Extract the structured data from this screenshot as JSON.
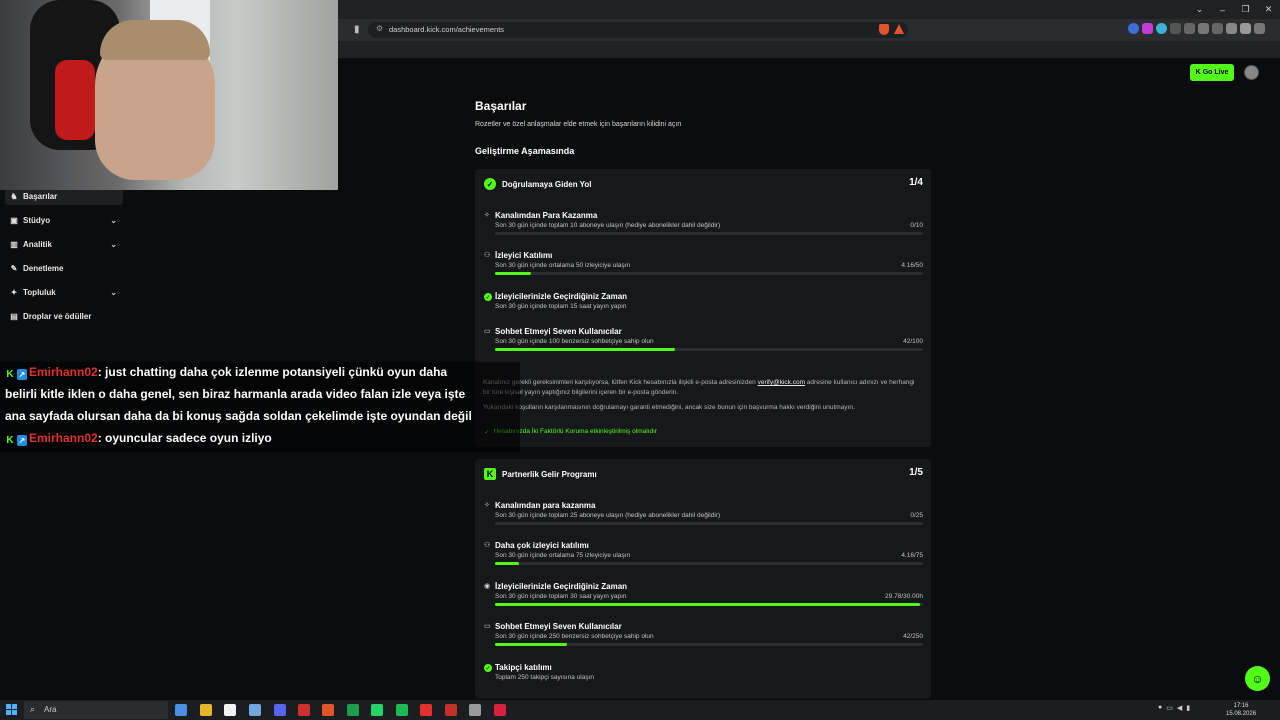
{
  "browser": {
    "url": "dashboard.kick.com/achievements",
    "window_controls": [
      "⌄",
      "–",
      "❐",
      "✕"
    ]
  },
  "header": {
    "go_live_label": "Go Live"
  },
  "sidebar": {
    "items": [
      {
        "label": "Başarılar",
        "icon": "trophy-icon",
        "glyph": "♞",
        "expand": false,
        "active": true
      },
      {
        "label": "Stüdyo",
        "icon": "studio-icon",
        "glyph": "▣",
        "expand": true,
        "active": false
      },
      {
        "label": "Analitik",
        "icon": "analytics-icon",
        "glyph": "▥",
        "expand": true,
        "active": false
      },
      {
        "label": "Denetleme",
        "icon": "moderation-icon",
        "glyph": "✎",
        "expand": false,
        "active": false
      },
      {
        "label": "Topluluk",
        "icon": "community-icon",
        "glyph": "✦",
        "expand": true,
        "active": false
      },
      {
        "label": "Droplar ve ödüller",
        "icon": "drops-icon",
        "glyph": "▤",
        "expand": false,
        "active": false
      }
    ]
  },
  "main": {
    "title": "Başarılar",
    "subtitle": "Rozetler ve özel anlaşmalar elde etmek için başarıların kilidini açın",
    "section_title": "Geliştirme Aşamasında",
    "verified_card": {
      "title": "Doğrulamaya Giden Yol",
      "count": "1/4",
      "tasks": [
        {
          "title": "Kanalımdan Para Kazanma",
          "desc": "Son 30 gün içinde toplam 10 aboneye ulaşın (hediye abonelikler dahil değildir)",
          "value": "0/10",
          "progress": 0.0,
          "icon": "money-icon",
          "glyph": "✧",
          "done": false
        },
        {
          "title": "İzleyici Katılımı",
          "desc": "Son 30 gün içinde ortalama 50 izleyiciye ulaşın",
          "value": "4.16/50",
          "progress": 0.083,
          "icon": "viewers-icon",
          "glyph": "⚇",
          "done": false
        },
        {
          "title": "İzleyicilerinizle Geçirdiğiniz Zaman",
          "desc": "Son 30 gün içinde toplam 15 saat yayın yapın",
          "value": "",
          "progress": null,
          "icon": "check-circle-icon",
          "glyph": "✓",
          "done": true
        },
        {
          "title": "Sohbet Etmeyi Seven Kullanıcılar",
          "desc": "Son 30 gün içinde 100 benzersiz sohbetçiye sahip olun",
          "value": "42/100",
          "progress": 0.42,
          "icon": "chat-icon",
          "glyph": "▭",
          "done": false
        }
      ],
      "info_text1_a": "Kanalınız gerekli gereksinimleri karşılıyorsa, lütfen Kick hesabınızla ilişkili e-posta adresinizden ",
      "info_link": "verify@kick.com",
      "info_text1_b": " adresine kullanıcı adınızı ve herhangi bir türe kişisel yayın yaptığınız bilgilerini içeren bir e-posta gönderin.",
      "info_text2": "Yukarıdaki koşulların karşılanmasının doğrulamayı garanti etmediğini, ancak size bunun için başvurma hakkı verdiğini unutmayın.",
      "requirement": "Hesabınızda İki Faktörlü Koruma etkinleştirilmiş olmalıdır"
    },
    "partner_card": {
      "title": "Partnerlik Gelir Programı",
      "count": "1/5",
      "tasks": [
        {
          "title": "Kanalımdan para kazanma",
          "desc": "Son 30 gün içinde toplam 25 aboneye ulaşın (hediye abonelikler dahil değildir)",
          "value": "0/25",
          "progress": 0.0,
          "icon": "money-icon",
          "glyph": "✧",
          "done": false
        },
        {
          "title": "Daha çok izleyici katılımı",
          "desc": "Son 30 gün içinde ortalama 75 izleyiciye ulaşın",
          "value": "4.16/75",
          "progress": 0.055,
          "icon": "viewers-icon",
          "glyph": "⚇",
          "done": false
        },
        {
          "title": "İzleyicilerinizle Geçirdiğiniz Zaman",
          "desc": "Son 30 gün içinde toplam 30 saat yayın yapın",
          "value": "29.78/30.00h",
          "progress": 0.993,
          "icon": "broadcast-icon",
          "glyph": "◉",
          "done": false
        },
        {
          "title": "Sohbet Etmeyi Seven Kullanıcılar",
          "desc": "Son 30 gün içinde 250 benzersiz sohbetçiye sahip olun",
          "value": "42/250",
          "progress": 0.168,
          "icon": "chat-icon",
          "glyph": "▭",
          "done": false
        },
        {
          "title": "Takipçi katılımı",
          "desc": "Toplam 250 takipçi sayısına ulaşın",
          "value": "",
          "progress": null,
          "icon": "check-circle-icon",
          "glyph": "✓",
          "done": true
        }
      ]
    }
  },
  "chat": {
    "messages": [
      {
        "user": "Emirhann02",
        "lines": [
          ": just chatting daha çok izlenme potansiyeli çünkü oyun daha",
          "belirli kitle iklen o daha genel, sen biraz harmanla arada video falan izle veya işte",
          "ana sayfada olursan daha da bi konuş sağda soldan çekelimde işte oyundan değil"
        ]
      },
      {
        "user": "Emirhann02",
        "lines": [
          ": oyuncular sadece oyun izliyo"
        ]
      }
    ]
  },
  "taskbar": {
    "search_placeholder": "Ara",
    "time": "17:16",
    "date": "15.08.2026",
    "apps": [
      "#4a90e2",
      "#e8b52a",
      "#f2f2f2",
      "#6fa7de",
      "#5865f2",
      "#d0312d",
      "#e2552c",
      "#1e9e4a",
      "#25d366",
      "#1db954",
      "#e0332f",
      "#c4302b",
      "#9a9a9a",
      "#d81f3c"
    ]
  },
  "colors": {
    "accent": "#53fc18",
    "background": "#0b0c0e",
    "card": "#17181b",
    "chat_user": "#e0332f"
  }
}
